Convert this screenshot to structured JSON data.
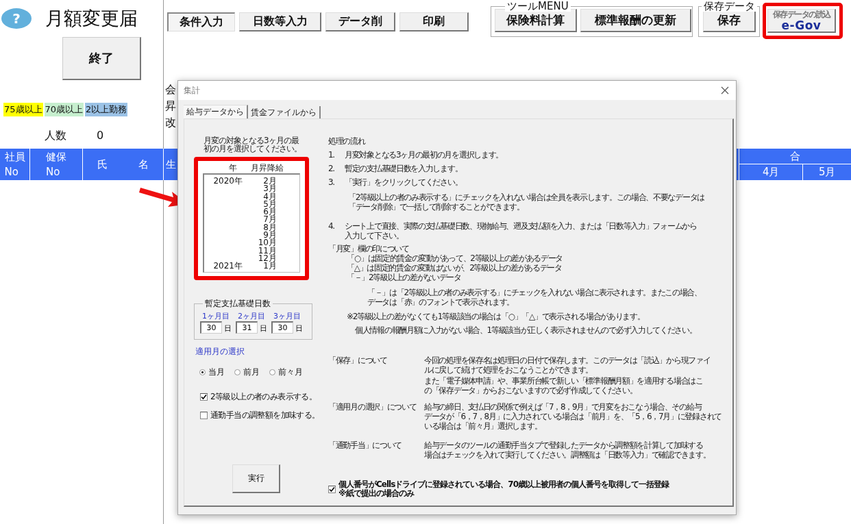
{
  "help_button": "?",
  "title": "月額変更届",
  "exit_button": "終了",
  "legend": [
    {
      "label": "75歳以上",
      "color": "#ffff00"
    },
    {
      "label": "70歳以上",
      "color": "#c6efce"
    },
    {
      "label": "2以上勤務",
      "color": "#9bc2e6"
    }
  ],
  "headcount": {
    "label": "人数",
    "value": "0"
  },
  "toolbar": [
    {
      "label": "条件入力",
      "selected": true
    },
    {
      "label": "日数等入力",
      "selected": false
    },
    {
      "label": "データ削",
      "selected": false
    },
    {
      "label": "印刷",
      "selected": false
    }
  ],
  "tool_menu": {
    "title": "ツールMENU",
    "buttons": [
      "保険料計算",
      "標準報酬の更新"
    ]
  },
  "save_data": {
    "title": "保存データ",
    "button": "保存"
  },
  "egov_button": {
    "caption": "保存データの読込",
    "logo": "e-Gov",
    "highlighted": true
  },
  "partial_labels": [
    "会",
    "昇",
    "改"
  ],
  "table": {
    "columns": [
      {
        "top": "社員",
        "bottom": "No"
      },
      {
        "top": "健保",
        "bottom": "No"
      },
      {
        "top": "氏　　　名"
      },
      {
        "top": "生"
      }
    ],
    "group": {
      "title": "合",
      "columns": [
        "4月",
        "5月"
      ]
    }
  },
  "dialog": {
    "title": "集計",
    "tabs": [
      {
        "label": "給与データから",
        "selected": true
      },
      {
        "label": "賃金ファイルから",
        "selected": false
      }
    ],
    "instruction": [
      "月変の対象となる3ヶ月の最",
      "初の月を選択してください。"
    ],
    "month_list": {
      "highlighted": true,
      "columns": [
        "年",
        "月昇降給"
      ],
      "rows": [
        {
          "year": "2020年",
          "month": "2月"
        },
        {
          "month": "3月"
        },
        {
          "month": "4月"
        },
        {
          "month": "5月"
        },
        {
          "month": "6月"
        },
        {
          "month": "7月"
        },
        {
          "month": "8月"
        },
        {
          "month": "9月"
        },
        {
          "month": "10月"
        },
        {
          "month": "11月"
        },
        {
          "month": "12月"
        },
        {
          "year": "2021年",
          "month": "1月"
        }
      ]
    },
    "days_group": {
      "title": "暫定支払基礎日数",
      "items": [
        {
          "label": "1ヶ月目",
          "value": "30",
          "unit": "日"
        },
        {
          "label": "2ヶ月目",
          "value": "31",
          "unit": "日"
        },
        {
          "label": "3ヶ月目",
          "value": "30",
          "unit": "日"
        }
      ]
    },
    "month_choice": {
      "title": "適用月の選択",
      "options": [
        {
          "label": "当月",
          "selected": true
        },
        {
          "label": "前月",
          "selected": false
        },
        {
          "label": "前々月",
          "selected": false
        }
      ]
    },
    "checkboxes": [
      {
        "label": "2等級以上の者のみ表示する。",
        "checked": true
      },
      {
        "label": "通勤手当の調整額を加味する。",
        "checked": false
      }
    ],
    "run_button": "実行",
    "help": [
      {
        "kind": "heading",
        "lines": [
          "処理の流れ"
        ]
      },
      {
        "kind": "step",
        "number": "1.",
        "lines": [
          "月変対象となる3ヶ月の最初の月を選択します。"
        ]
      },
      {
        "kind": "step",
        "number": "2.",
        "lines": [
          "暫定の支払基礎日数を入力します。"
        ]
      },
      {
        "kind": "step",
        "number": "3.",
        "lines": [
          "「実行」をクリックしてください。"
        ]
      },
      {
        "kind": "note",
        "lines": [
          "「2等級以上の者のみ表示する」にチェックを入れない場合は全員を表示します。この場合、不要なデータは",
          "「データ削除」で一括して削除することができます。"
        ]
      },
      {
        "kind": "step",
        "number": "4.",
        "lines": [
          "シート上で直接、実際の支払基礎日数、現物給与、遡及支払額を入力、または「日数等入力」フォームから",
          "入力して下さい。"
        ]
      },
      {
        "kind": "heading",
        "lines": [
          "「月変」欄の印について"
        ]
      },
      {
        "kind": "mark",
        "lines": [
          "「○」は固定的賃金の変動があって、2等級以上の差があるデータ"
        ]
      },
      {
        "kind": "mark",
        "lines": [
          "「△」は固定的賃金の変動はないが、2等級以上の差があるデータ"
        ]
      },
      {
        "kind": "mark",
        "lines": [
          "「－」2等級以上の差がないデータ"
        ]
      },
      {
        "kind": "subnote",
        "lines": [
          "「－」は「2等級以上の者のみ表示する」にチェックを入れない場合に表示されます。またこの場合、",
          "データは「赤」のフォントで表示されます。"
        ]
      },
      {
        "kind": "remark",
        "lines": [
          "※2等級以上の差がなくても1等級該当の場合は「○」「△」で表示される場合があります。"
        ]
      },
      {
        "kind": "remark2",
        "lines": [
          "個人情報の報酬月額に入力がない場合、1等級該当が正しく表示されませんので必ず入力してください。"
        ]
      }
    ],
    "sections": [
      {
        "title": "「保存」について",
        "paragraphs": [
          [
            "今回の処理を保存名は処理日の日付で保存します。このデータは「読込」から現ファイ",
            "ルに戻して続けて処理をおこなうことができます。"
          ],
          [
            "また「電子媒体申請」や、事業所台帳で新しい「標準報酬月額」を適用する場合はこ",
            "の「保存データ」からおこないますので必ず作成してください。"
          ]
        ]
      },
      {
        "title": "「適用月の選択」について",
        "paragraphs": [
          [
            "給与の締日、支払日の関係で例えば「7，8，9月」で月変をおこなう場合、その給与",
            "データが「6，7，8月」に入力されている場合は「前月」を、「5，6，7月」に登録されて",
            "いる場合は「前々月」選択します。"
          ]
        ]
      },
      {
        "title": "「通勤手当」について",
        "paragraphs": [
          [
            "給与データのツールの通勤手当タブで登録したデータから調整額を計算して加味する",
            "場合はチェックを入れて実行してください。調整額は「日数等入力」で確認できます。"
          ]
        ]
      }
    ],
    "bulk_register": {
      "checked": true,
      "lines": [
        "個人番号がCellsドライブに登録されている場合、70歳以上被用者の個人番号を取得して一括登録",
        "※紙で提出の場合のみ"
      ]
    }
  }
}
